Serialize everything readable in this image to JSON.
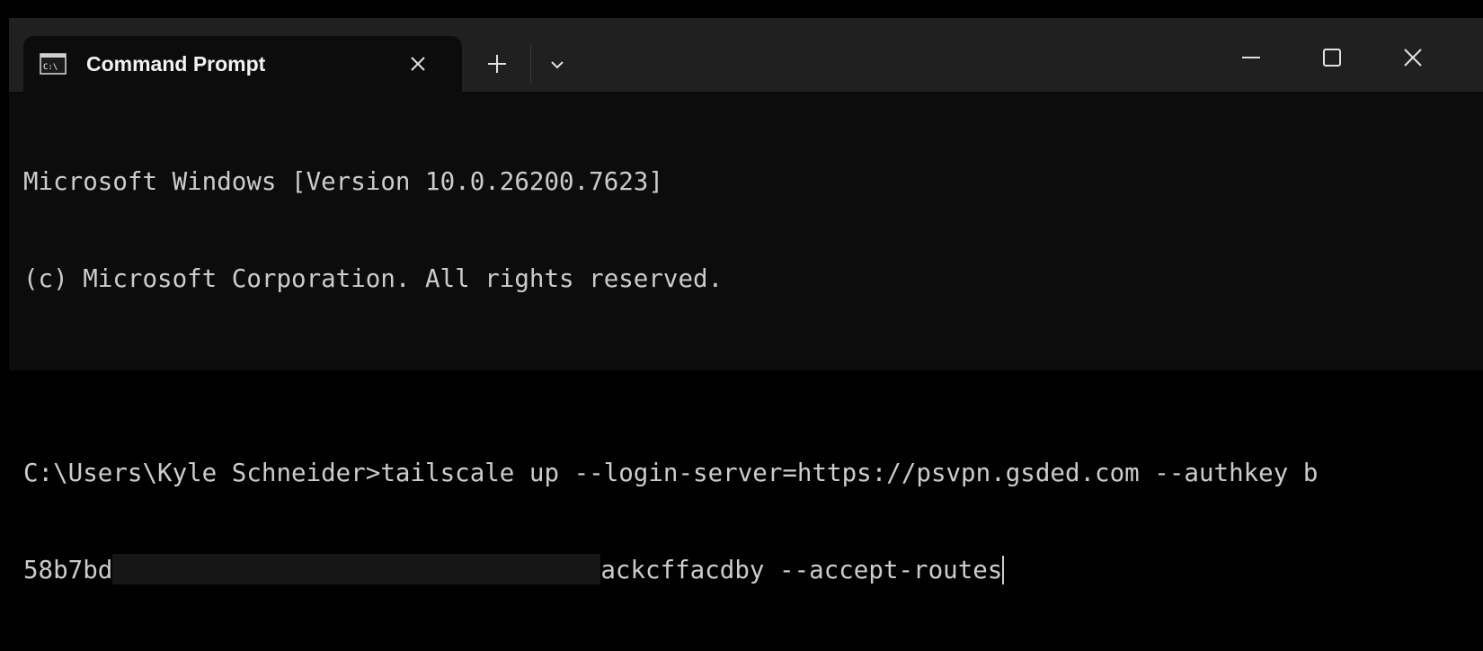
{
  "window": {
    "tab_title": "Command Prompt",
    "tab_icon": "cmd-icon",
    "buttons": {
      "tab_close": "close-icon",
      "new_tab": "plus-icon",
      "dropdown": "chevron-down-icon",
      "minimize": "minimize-icon",
      "maximize": "maximize-icon",
      "close": "close-icon"
    }
  },
  "terminal": {
    "line1": "Microsoft Windows [Version 10.0.26200.7623]",
    "line2": "(c) Microsoft Corporation. All rights reserved.",
    "line3": "",
    "line4": "C:\\Users\\Kyle Schneider>tailscale up --login-server=https://psvpn.gsded.com --authkey b",
    "line5_start": "58b7bd",
    "line5_end": "ackcffacdby --accept-routes"
  },
  "colors": {
    "background": "#0c0c0c",
    "titlebar": "#202020",
    "text": "#cccccc"
  }
}
